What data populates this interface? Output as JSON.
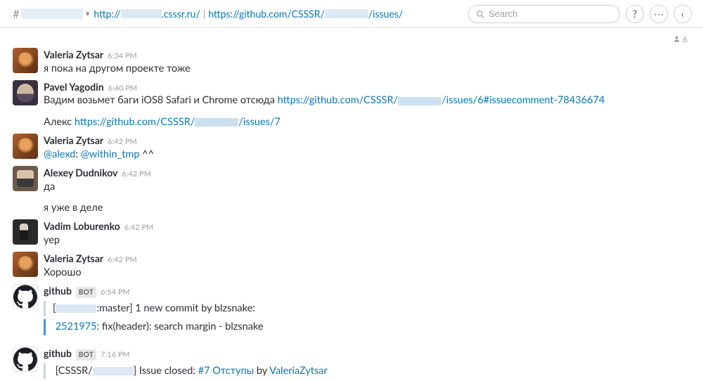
{
  "header": {
    "hash": "#",
    "topic_part1": "http://",
    "topic_part2": ".csssr.ru/",
    "topic_sep": "|",
    "topic_part3": "https://github.com/CSSSR/",
    "topic_part4": "/issues/",
    "search_placeholder": "Search",
    "help": "?",
    "more": "⋯",
    "back": "‹"
  },
  "subheader": {
    "member_count": "6"
  },
  "messages": [
    {
      "author": "Valeria Zytsar",
      "ts": "6:34 PM",
      "avatar": "tiger",
      "lines": [
        "я пока на другом проекте тоже"
      ]
    },
    {
      "author": "Pavel Yagodin",
      "ts": "6:40 PM",
      "avatar": "monk",
      "line1_pre": "Вадим возьмет баги  iOS8 Safari и Chrome отсюда ",
      "line1_link1": "https://github.com/CSSSR/",
      "line1_link2": "/issues/6#issuecomment-78436674",
      "line2_pre": "Алекс ",
      "line2_link1": "https://github.com/CSSSR/",
      "line2_link2": "/issues/7"
    },
    {
      "author": "Valeria Zytsar",
      "ts": "6:42 PM",
      "avatar": "tiger",
      "mention1": "@alexd",
      "colon": ": ",
      "mention2": "@within_tmp",
      "suffix": " ^^"
    },
    {
      "author": "Alexey Dudnikov",
      "ts": "6:42 PM",
      "avatar": "alex",
      "line1": "да",
      "line2": "я уже в деле"
    },
    {
      "author": "Vadim Loburenko",
      "ts": "6:42 PM",
      "avatar": "vadim",
      "line1": "yep"
    },
    {
      "author": "Valeria Zytsar",
      "ts": "6:42 PM",
      "avatar": "tiger",
      "line1": "Хорошо"
    },
    {
      "author": "github",
      "bot": "BOT",
      "ts": "6:54 PM",
      "avatar": "gh",
      "att_pre": "[",
      "att_mid": ":master] 1 new commit by blzsnake:",
      "commit_hash": "2521975",
      "commit_msg": ": fix(header): search margin - blzsnake"
    },
    {
      "author": "github",
      "bot": "BOT",
      "ts": "7:16 PM",
      "avatar": "gh",
      "att_pre": "[CSSSR/",
      "att_mid": "] Issue closed: ",
      "issue_link": "#7 Отступы",
      "by": " by ",
      "closer": "ValeriaZytsar"
    }
  ]
}
